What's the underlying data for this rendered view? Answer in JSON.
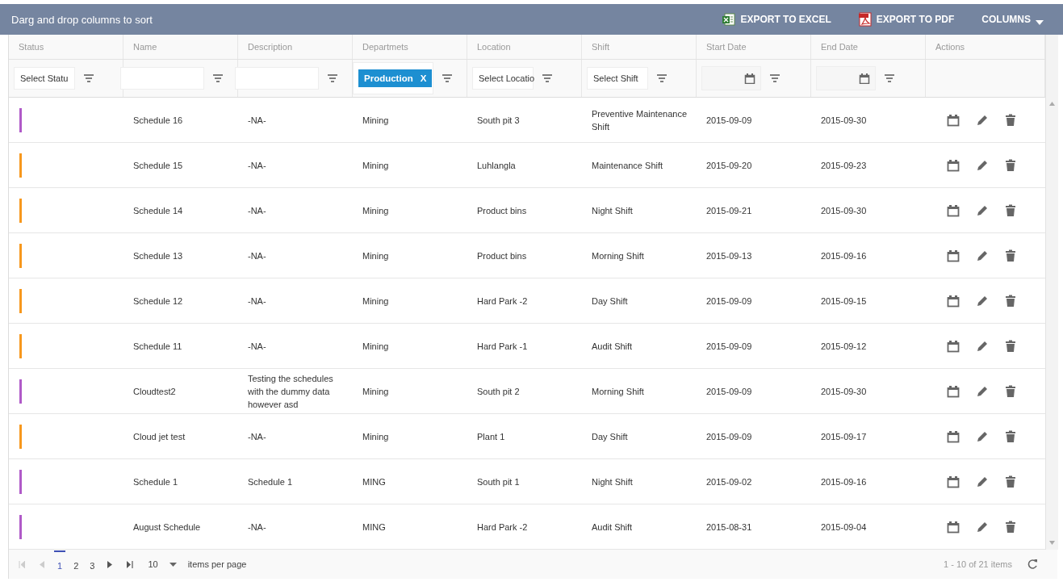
{
  "toolbar": {
    "hint": "Darg and drop columns to sort",
    "actions": [
      {
        "kind": "excel",
        "label": "EXPORT TO EXCEL"
      },
      {
        "kind": "pdf",
        "label": "EXPORT TO PDF"
      },
      {
        "kind": "menu",
        "label": "COLUMNS"
      }
    ]
  },
  "columns": [
    {
      "title": "Status",
      "filter": {
        "kind": "select",
        "value": "Select Statu"
      }
    },
    {
      "title": "Name",
      "filter": {
        "kind": "text"
      }
    },
    {
      "title": "Description",
      "filter": {
        "kind": "text"
      }
    },
    {
      "title": "Departmets",
      "filter": {
        "kind": "tag",
        "value": "Production",
        "remove": "X"
      }
    },
    {
      "title": "Location",
      "filter": {
        "kind": "select",
        "value": "Select Locatio"
      }
    },
    {
      "title": "Shift",
      "filter": {
        "kind": "select",
        "value": "Select Shift"
      }
    },
    {
      "title": "Start Date",
      "filter": {
        "kind": "date"
      }
    },
    {
      "title": "End Date",
      "filter": {
        "kind": "date"
      }
    },
    {
      "title": "Actions",
      "filter": {
        "kind": "none"
      }
    }
  ],
  "rows": [
    {
      "color": "#b05ac8",
      "name": "Schedule 16",
      "description": "-NA-",
      "department": "Mining",
      "location": "South pit 3",
      "shift": "Preventive Maintenance Shift",
      "start": "2015-09-09",
      "end": "2015-09-30"
    },
    {
      "color": "#f7981d",
      "name": "Schedule 15",
      "description": "-NA-",
      "department": "Mining",
      "location": "Luhlangla",
      "shift": "Maintenance Shift",
      "start": "2015-09-20",
      "end": "2015-09-23"
    },
    {
      "color": "#f7981d",
      "name": "Schedule 14",
      "description": "-NA-",
      "department": "Mining",
      "location": "Product bins",
      "shift": "Night Shift",
      "start": "2015-09-21",
      "end": "2015-09-30"
    },
    {
      "color": "#f7981d",
      "name": "Schedule 13",
      "description": "-NA-",
      "department": "Mining",
      "location": "Product bins",
      "shift": "Morning Shift",
      "start": "2015-09-13",
      "end": "2015-09-16"
    },
    {
      "color": "#f7981d",
      "name": "Schedule 12",
      "description": "-NA-",
      "department": "Mining",
      "location": "Hard Park -2",
      "shift": "Day Shift",
      "start": "2015-09-09",
      "end": "2015-09-15"
    },
    {
      "color": "#f7981d",
      "name": "Schedule 11",
      "description": "-NA-",
      "department": "Mining",
      "location": "Hard Park -1",
      "shift": "Audit Shift",
      "start": "2015-09-09",
      "end": "2015-09-12"
    },
    {
      "color": "#b05ac8",
      "name": "Cloudtest2",
      "description": "Testing the schedules with the dummy data however asd",
      "department": "Mining",
      "location": "South pit 2",
      "shift": "Morning Shift",
      "start": "2015-09-09",
      "end": "2015-09-30"
    },
    {
      "color": "#f7981d",
      "name": "Cloud jet test",
      "description": "-NA-",
      "department": "Mining",
      "location": "Plant 1",
      "shift": "Day Shift",
      "start": "2015-09-09",
      "end": "2015-09-17"
    },
    {
      "color": "#b05ac8",
      "name": "Schedule 1",
      "description": "Schedule 1",
      "department": "MING",
      "location": "South pit 1",
      "shift": "Night Shift",
      "start": "2015-09-02",
      "end": "2015-09-16"
    },
    {
      "color": "#b05ac8",
      "name": "August Schedule",
      "description": "-NA-",
      "department": "MING",
      "location": "Hard Park -2",
      "shift": "Audit Shift",
      "start": "2015-08-31",
      "end": "2015-09-04"
    }
  ],
  "pager": {
    "first_disabled": true,
    "prev_disabled": true,
    "pages": [
      {
        "label": "1",
        "selected": true
      },
      {
        "label": "2",
        "selected": false
      },
      {
        "label": "3",
        "selected": false
      }
    ],
    "page_size": "10",
    "page_size_label": "items per page",
    "summary": "1 - 10 of 21 items"
  }
}
